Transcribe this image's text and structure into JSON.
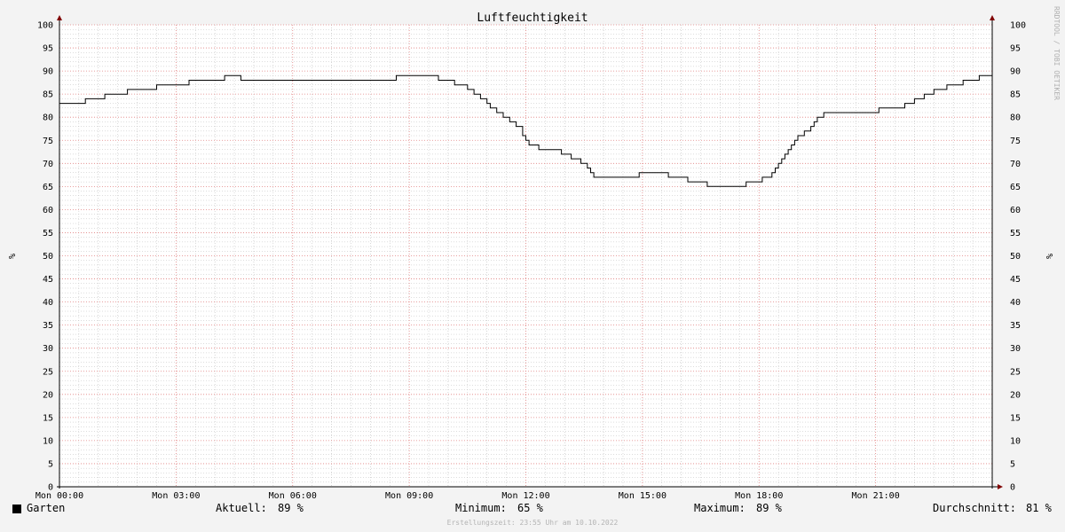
{
  "chart_data": {
    "type": "line",
    "title": "Luftfeuchtigkeit",
    "ylabel_left": "%",
    "ylabel_right": "%",
    "ylim": [
      0,
      100
    ],
    "y_ticks": [
      0,
      5,
      10,
      15,
      20,
      25,
      30,
      35,
      40,
      45,
      50,
      55,
      60,
      65,
      70,
      75,
      80,
      85,
      90,
      95,
      100
    ],
    "xlim": [
      "Mon 00:00",
      "Mon 24:00"
    ],
    "x_tick_labels": [
      "Mon 00:00",
      "Mon 03:00",
      "Mon 06:00",
      "Mon 09:00",
      "Mon 12:00",
      "Mon 15:00",
      "Mon 18:00",
      "Mon 21:00"
    ],
    "grid": true,
    "series": [
      {
        "name": "Garten",
        "color": "#000000",
        "x": [
          "00:00",
          "00:10",
          "00:40",
          "01:10",
          "01:45",
          "02:30",
          "03:20",
          "03:45",
          "04:15",
          "04:40",
          "07:40",
          "08:40",
          "09:15",
          "09:45",
          "10:10",
          "10:30",
          "10:40",
          "10:50",
          "11:00",
          "11:05",
          "11:15",
          "11:25",
          "11:35",
          "11:45",
          "11:55",
          "12:00",
          "12:05",
          "12:20",
          "12:35",
          "12:55",
          "13:10",
          "13:25",
          "13:35",
          "13:40",
          "13:45",
          "13:50",
          "14:15",
          "14:25",
          "14:55",
          "15:05",
          "15:40",
          "16:10",
          "16:40",
          "17:10",
          "17:40",
          "17:55",
          "18:05",
          "18:10",
          "18:15",
          "18:20",
          "18:25",
          "18:30",
          "18:35",
          "18:40",
          "18:45",
          "18:50",
          "18:55",
          "19:00",
          "19:10",
          "19:20",
          "19:25",
          "19:30",
          "19:40",
          "20:30",
          "20:45",
          "21:00",
          "21:05",
          "21:15",
          "21:30",
          "21:45",
          "22:00",
          "22:15",
          "22:30",
          "22:50",
          "23:15",
          "23:40",
          "24:00"
        ],
        "values": [
          83,
          83,
          84,
          85,
          86,
          87,
          88,
          88,
          89,
          88,
          88,
          89,
          89,
          88,
          87,
          86,
          85,
          84,
          83,
          82,
          81,
          80,
          79,
          78,
          76,
          75,
          74,
          73,
          73,
          72,
          71,
          70,
          69,
          68,
          67,
          67,
          67,
          67,
          68,
          68,
          67,
          66,
          65,
          65,
          66,
          66,
          67,
          67,
          67,
          68,
          69,
          70,
          71,
          72,
          73,
          74,
          75,
          76,
          77,
          78,
          79,
          80,
          81,
          81,
          81,
          81,
          82,
          82,
          82,
          83,
          84,
          85,
          86,
          87,
          88,
          89,
          89
        ]
      }
    ]
  },
  "legend": {
    "series_name": "Garten",
    "swatch_color": "#000000"
  },
  "stats": {
    "current_label": "Aktuell:",
    "current_value": "89 %",
    "min_label": "Minimum:",
    "min_value": "65 %",
    "max_label": "Maximum:",
    "max_value": "89 %",
    "avg_label": "Durchschnitt:",
    "avg_value": "81 %"
  },
  "watermark": "RRDTOOL / TOBI OETIKER",
  "created_text": "Erstellungszeit: 23:55 Uhr am 10.10.2022",
  "colors": {
    "background": "#f3f3f3",
    "plot_background": "#ffffff",
    "major_grid": "#e08080",
    "minor_grid": "#bbbbbb",
    "axis": "#000000",
    "arrow": "#800000",
    "line": "#000000"
  }
}
